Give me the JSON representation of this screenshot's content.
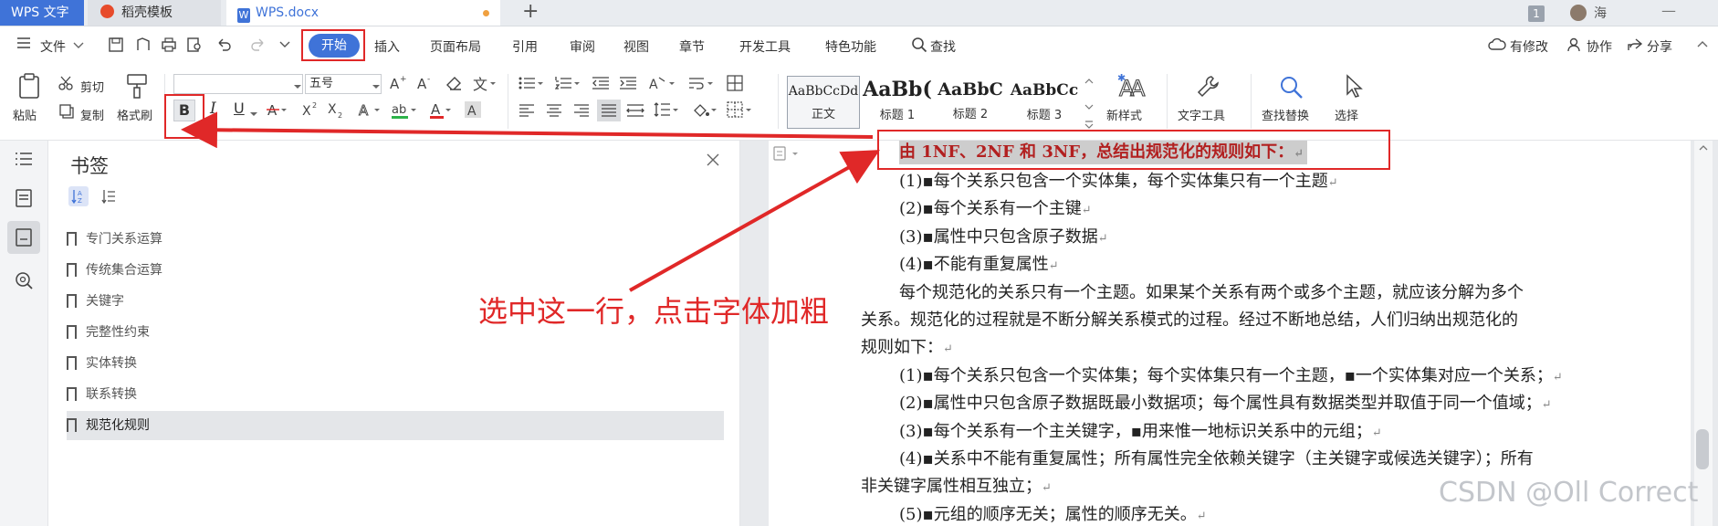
{
  "tabbar": {
    "app_tab": "WPS 文字",
    "template_tab": "稻壳模板",
    "doc_tab": "WPS.docx",
    "add_icon": "+",
    "page_badge": "1",
    "user_name": "海",
    "minimize_icon": "—"
  },
  "menubar": {
    "file": "文件",
    "tabs": [
      "开始",
      "插入",
      "页面布局",
      "引用",
      "审阅",
      "视图",
      "章节",
      "开发工具",
      "特色功能"
    ],
    "search": "查找",
    "right": [
      "有修改",
      "协作",
      "分享"
    ]
  },
  "ribbon": {
    "cut": "剪切",
    "copy": "复制",
    "paste": "粘贴",
    "format_painter": "格式刷",
    "font_name": "",
    "font_size": "五号",
    "bold": "B",
    "italic": "I",
    "underline": "U",
    "styles": [
      {
        "sample": "AaBbCcDd",
        "name": "正文"
      },
      {
        "sample": "AaBb(",
        "name": "标题 1"
      },
      {
        "sample": "AaBbC",
        "name": "标题 2"
      },
      {
        "sample": "AaBbCc",
        "name": "标题 3"
      }
    ],
    "new_style": "新样式",
    "text_tools": "文字工具",
    "find_replace": "查找替换",
    "select": "选择"
  },
  "panel": {
    "title": "书签",
    "bookmarks": [
      "专门关系运算",
      "传统集合运算",
      "关键字",
      "完整性约束",
      "实体转换",
      "联系转换",
      "规范化规则"
    ],
    "selected_index": 6
  },
  "document": {
    "heading": "由 1NF、2NF 和 3NF，总结出规范化的规则如下：",
    "lines": [
      "(1)▪每个关系只包含一个实体集，每个实体集只有一个主题",
      "(2)▪每个关系有一个主键",
      "(3)▪属性中只包含原子数据",
      "(4)▪不能有重复属性",
      "每个规范化的关系只有一个主题。如果某个关系有两个或多个主题，就应该分解为多个",
      "关系。规范化的过程就是不断分解关系模式的过程。经过不断地总结，人们归纳出规范化的",
      "规则如下：",
      "(1)▪每个关系只包含一个实体集；每个实体集只有一个主题，▪一个实体集对应一个关系；",
      "(2)▪属性中只包含原子数据既最小数据项；每个属性具有数据类型并取值于同一个值域；",
      "(3)▪每个关系有一个主关键字，▪用来惟一地标识关系中的元组；",
      "(4)▪关系中不能有重复属性；所有属性完全依赖关键字（主关键字或候选关键字）；所有",
      "非关键字属性相互独立；",
      "(5)▪元组的顺序无关；属性的顺序无关。"
    ]
  },
  "annotation": "选中这一行，点击字体加粗",
  "watermark": "CSDN @Oll Correct",
  "colors": {
    "accent": "#3f73d8",
    "annotation": "#e02828",
    "selection": "#c8c8c8"
  }
}
